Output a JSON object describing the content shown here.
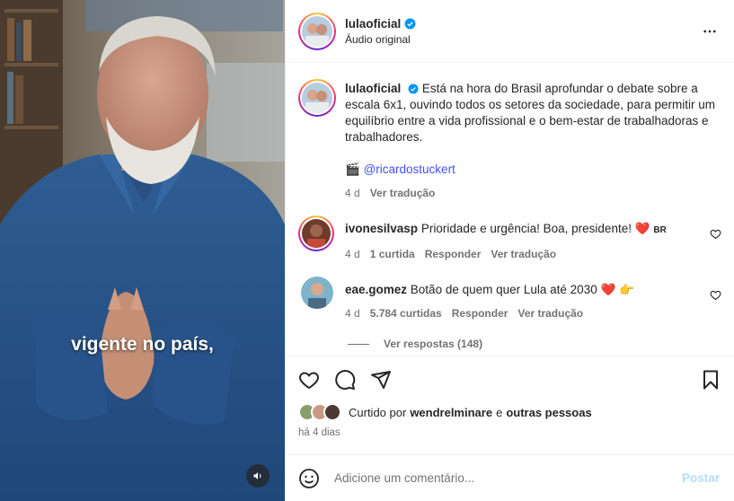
{
  "video": {
    "subtitle": "vigente no país,"
  },
  "header": {
    "username": "lulaoficial",
    "subtitle": "Áudio original"
  },
  "caption": {
    "username": "lulaoficial",
    "text": "Está na hora do Brasil aprofundar o debate sobre a escala 6x1, ouvindo todos os setores da sociedade, para permitir um equilíbrio entre a vida profissional e o bem-estar de trabalhadoras e trabalhadores.",
    "credit_emoji": "🎬",
    "mention": "@ricardostuckert",
    "age": "4 d",
    "translate": "Ver tradução"
  },
  "comments": [
    {
      "username": "ivonesilvasp",
      "text": "Prioridade e urgência! Boa, presidente!",
      "emoji": "❤️",
      "flag": "BR",
      "age": "4 d",
      "likes": "1 curtida",
      "reply": "Responder",
      "translate": "Ver tradução"
    },
    {
      "username": "eae.gomez",
      "text": "Botão de quem quer Lula até 2030",
      "emoji": "❤️",
      "emoji2": "👉",
      "age": "4 d",
      "likes": "5.784 curtidas",
      "reply": "Responder",
      "translate": "Ver tradução"
    }
  ],
  "view_replies": "Ver respostas (148)",
  "likes": {
    "prefix": "Curtido por",
    "user": "wendrelminare",
    "joiner": "e",
    "others": "outras pessoas"
  },
  "post_date": "há 4 dias",
  "composer": {
    "placeholder": "Adicione um comentário...",
    "post_label": "Postar"
  },
  "colors": {
    "link": "#4150f7",
    "secondary_text": "#737373",
    "post_disabled": "#b3dbff",
    "verified": "#0095f6",
    "heart": "#ff3040"
  }
}
